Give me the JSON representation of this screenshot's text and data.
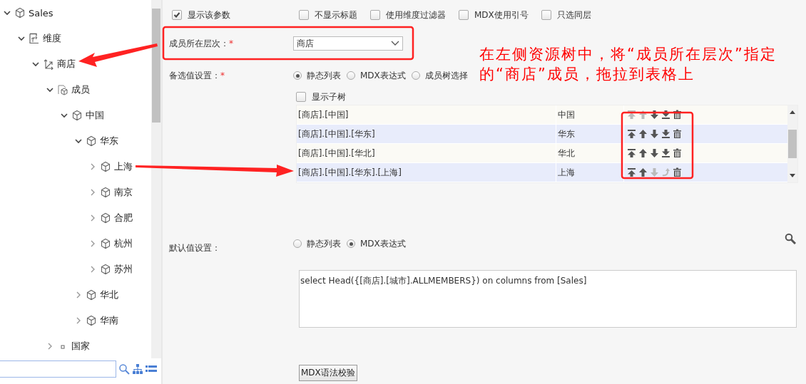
{
  "tree": {
    "items": [
      {
        "label": "Sales",
        "kind": "cube",
        "expanded": true,
        "children": [
          {
            "label": "维度",
            "kind": "dimension",
            "expanded": true,
            "children": [
              {
                "label": "商店",
                "kind": "hierarchy",
                "expanded": true,
                "children": [
                  {
                    "label": "成员",
                    "kind": "members",
                    "expanded": true,
                    "children": [
                      {
                        "label": "中国",
                        "kind": "cube",
                        "expanded": true,
                        "children": [
                          {
                            "label": "华东",
                            "kind": "cube",
                            "expanded": true,
                            "children": [
                              {
                                "label": "上海",
                                "kind": "cube",
                                "expanded": false
                              },
                              {
                                "label": "南京",
                                "kind": "cube",
                                "expanded": false
                              },
                              {
                                "label": "合肥",
                                "kind": "cube",
                                "expanded": false
                              },
                              {
                                "label": "杭州",
                                "kind": "cube",
                                "expanded": false
                              },
                              {
                                "label": "苏州",
                                "kind": "cube",
                                "expanded": false
                              }
                            ]
                          },
                          {
                            "label": "华北",
                            "kind": "cube",
                            "expanded": false
                          },
                          {
                            "label": "华南",
                            "kind": "cube",
                            "expanded": false
                          }
                        ]
                      }
                    ]
                  },
                  {
                    "label": "国家",
                    "kind": "dot",
                    "expanded": false
                  }
                ]
              }
            ]
          }
        ]
      }
    ]
  },
  "options": [
    {
      "label": "显示该参数",
      "checked": true
    },
    {
      "label": "不显示标题",
      "checked": false
    },
    {
      "label": "使用维度过滤器",
      "checked": false
    },
    {
      "label": "MDX使用引号",
      "checked": false
    },
    {
      "label": "只选同层",
      "checked": false
    }
  ],
  "level_field": {
    "label": "成员所在层次：",
    "required_mark": "*",
    "value": "商店"
  },
  "candidates": {
    "label": "备选值设置：",
    "required_mark": "*",
    "modes": [
      {
        "label": "静态列表",
        "selected": true
      },
      {
        "label": "MDX表达式",
        "selected": false
      },
      {
        "label": "成员树选择",
        "selected": false
      }
    ],
    "show_subtree": {
      "label": "显示子树",
      "checked": false
    },
    "rows": [
      {
        "path": "[商店].[中国]",
        "name": "中国",
        "actions": [
          {
            "kind": "top",
            "disabled": true
          },
          {
            "kind": "up",
            "disabled": true
          },
          {
            "kind": "down",
            "disabled": false
          },
          {
            "kind": "bottom",
            "disabled": false
          },
          {
            "kind": "delete",
            "disabled": false
          }
        ]
      },
      {
        "path": "[商店].[中国].[华东]",
        "name": "华东",
        "actions": [
          {
            "kind": "top",
            "disabled": false
          },
          {
            "kind": "up",
            "disabled": false
          },
          {
            "kind": "down",
            "disabled": false
          },
          {
            "kind": "bottom",
            "disabled": false
          },
          {
            "kind": "delete",
            "disabled": false
          }
        ]
      },
      {
        "path": "[商店].[中国].[华北]",
        "name": "华北",
        "actions": [
          {
            "kind": "top",
            "disabled": false
          },
          {
            "kind": "up",
            "disabled": false
          },
          {
            "kind": "down",
            "disabled": false
          },
          {
            "kind": "bottom",
            "disabled": false
          },
          {
            "kind": "delete",
            "disabled": false
          }
        ]
      },
      {
        "path": "[商店].[中国].[华东].[上海]",
        "name": "上海",
        "actions": [
          {
            "kind": "top",
            "disabled": false
          },
          {
            "kind": "up",
            "disabled": false
          },
          {
            "kind": "down",
            "disabled": true
          },
          {
            "kind": "return",
            "disabled": true
          },
          {
            "kind": "delete",
            "disabled": false
          }
        ]
      }
    ]
  },
  "defaults": {
    "label": "默认值设置：",
    "modes": [
      {
        "label": "静态列表",
        "selected": false
      },
      {
        "label": "MDX表达式",
        "selected": true
      }
    ],
    "expression": "select Head({[商店].[城市].ALLMEMBERS}) on columns from [Sales]"
  },
  "validate_button": "MDX语法校验",
  "annotation": {
    "note": "在左侧资源树中，将“成员所在层次”指定的“商店”成员，拖拉到表格上"
  }
}
